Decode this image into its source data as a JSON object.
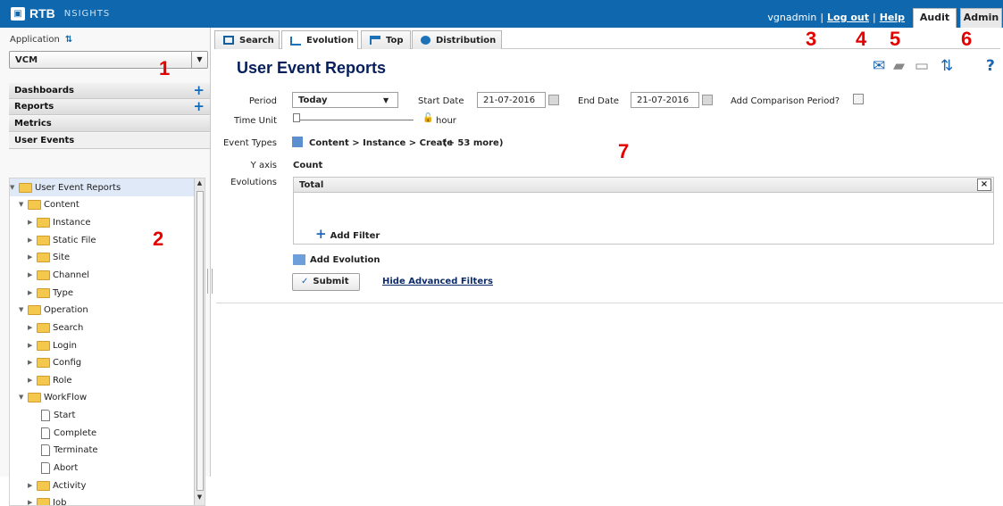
{
  "app": {
    "brand": "RTB",
    "subtitle": "NSIGHTS"
  },
  "top": {
    "username": "vgnadmin",
    "logout": "Log out",
    "help": "Help",
    "tabs": [
      {
        "label": "Audit"
      },
      {
        "label": "Admin"
      }
    ]
  },
  "sidebar": {
    "application_label": "Application",
    "application_select": "VCM",
    "sections": [
      {
        "label": "Dashboards"
      },
      {
        "label": "Reports"
      },
      {
        "label": "Metrics"
      },
      {
        "label": "User Events"
      }
    ],
    "tree": [
      {
        "label": "User Event Reports"
      },
      {
        "label": "Content"
      },
      {
        "label": "Instance"
      },
      {
        "label": "Static File"
      },
      {
        "label": "Site"
      },
      {
        "label": "Channel"
      },
      {
        "label": "Type"
      },
      {
        "label": "Operation"
      },
      {
        "label": "Search"
      },
      {
        "label": "Login"
      },
      {
        "label": "Config"
      },
      {
        "label": "Role"
      },
      {
        "label": "WorkFlow"
      },
      {
        "label": "Start"
      },
      {
        "label": "Complete"
      },
      {
        "label": "Terminate"
      },
      {
        "label": "Abort"
      },
      {
        "label": "Activity"
      },
      {
        "label": "Job"
      }
    ]
  },
  "main": {
    "tabs": [
      {
        "label": "Search"
      },
      {
        "label": "Evolution"
      },
      {
        "label": "Top"
      },
      {
        "label": "Distribution"
      }
    ],
    "title": "User Event Reports",
    "form": {
      "period_label": "Period",
      "period_value": "Today",
      "start_label": "Start Date",
      "start_value": "21-07-2016",
      "end_label": "End Date",
      "end_value": "21-07-2016",
      "comparison_label": "Add Comparison Period?",
      "time_unit_label": "Time Unit",
      "time_unit_value": "hour",
      "event_types_label": "Event Types",
      "event_types_value": "Content > Instance > Create",
      "event_types_more": "(+ 53 more)",
      "y_axis_label": "Y axis",
      "y_axis_value": "Count",
      "evolutions_label": "Evolutions",
      "evolution_header": "Total",
      "add_filter": "Add Filter",
      "add_evolution": "Add Evolution",
      "submit": "Submit",
      "hide_filters": "Hide Advanced Filters"
    }
  },
  "annotations": [
    "1",
    "2",
    "3",
    "4",
    "5",
    "6",
    "7"
  ]
}
